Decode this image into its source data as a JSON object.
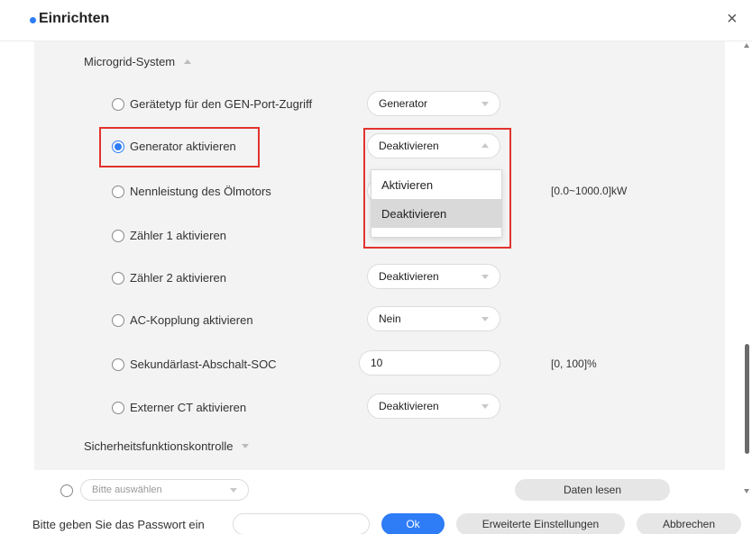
{
  "window": {
    "title": "Einrichten",
    "close_glyph": "×"
  },
  "sections": {
    "microgrid": "Microgrid-System",
    "safety": "Sicherheitsfunktionskontrolle"
  },
  "rows": {
    "gen_port": {
      "label": "Gerätetyp für den GEN-Port-Zugriff",
      "value": "Generator"
    },
    "gen_enable": {
      "label": "Generator aktivieren",
      "value": "Deaktivieren"
    },
    "oil_motor": {
      "label": "Nennleistung des Ölmotors",
      "range": "[0.0~1000.0]kW"
    },
    "meter1": {
      "label": "Zähler 1 aktivieren"
    },
    "meter2": {
      "label": "Zähler 2 aktivieren",
      "value": "Deaktivieren"
    },
    "ac_coupling": {
      "label": "AC-Kopplung aktivieren",
      "value": "Nein"
    },
    "secondary_soc": {
      "label": "Sekundärlast-Abschalt-SOC",
      "value": "10",
      "range": "[0, 100]%"
    },
    "external_ct": {
      "label": "Externer CT aktivieren",
      "value": "Deaktivieren"
    }
  },
  "dropdown": {
    "options": [
      "Aktivieren",
      "Deaktivieren"
    ],
    "selected": "Deaktivieren"
  },
  "bottom": {
    "select_placeholder": "Bitte auswählen",
    "read_button": "Daten lesen",
    "password_label": "Bitte geben Sie das Passwort ein",
    "ok_button": "Ok",
    "advanced_button": "Erweiterte Einstellungen",
    "cancel_button": "Abbrechen"
  },
  "colors": {
    "accent": "#2e7cf6",
    "highlight": "#e2332e",
    "panel": "#f3f3f3"
  }
}
